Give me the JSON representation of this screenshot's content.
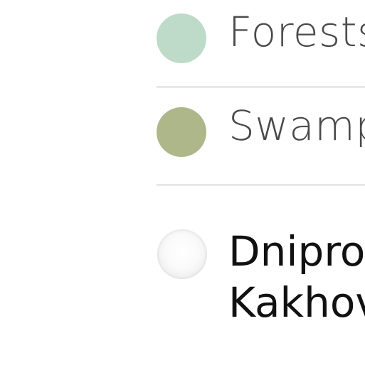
{
  "legend": {
    "items": [
      {
        "label": "Forests",
        "color": "#bddbc8",
        "icon": "forest-swatch"
      },
      {
        "label": "Swamp",
        "color": "#adb78a",
        "icon": "swamp-swatch"
      }
    ],
    "reservoir": {
      "line1": "Dnipro",
      "line2": "Kakhov",
      "icon": "reservoir-swatch"
    }
  }
}
